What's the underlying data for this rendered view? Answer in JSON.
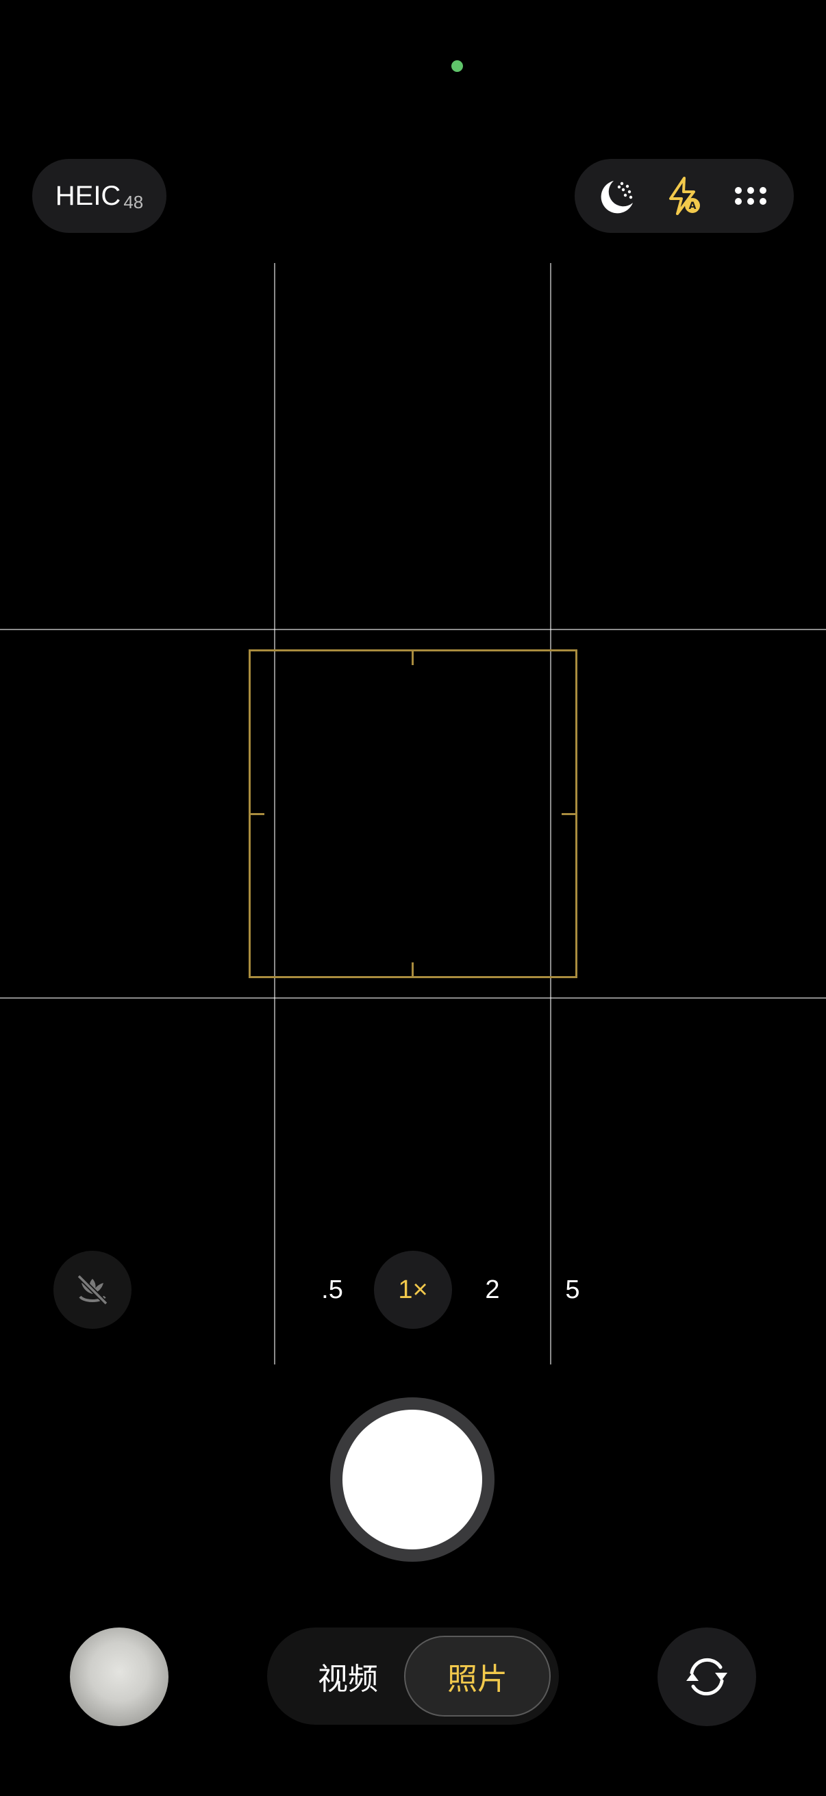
{
  "status": {
    "privacy_indicator_color": "#5fc46a"
  },
  "top_bar": {
    "format_label": "HEIC",
    "format_sub": "48",
    "quick_icons": [
      "night-mode-icon",
      "flash-auto-icon",
      "more-icon"
    ],
    "accent_color": "#f2c94c"
  },
  "viewfinder": {
    "grid": "3x3",
    "focus_color": "#a98c3e"
  },
  "zoom": {
    "macro_icon": "macro-off-icon",
    "options": [
      ".5",
      "1×",
      "2",
      "5"
    ],
    "selected": "1×"
  },
  "shutter": {
    "icon": "shutter-button"
  },
  "modes": {
    "items": [
      "视频",
      "照片"
    ],
    "selected": "照片"
  },
  "bottom": {
    "gallery_icon": "gallery-thumbnail",
    "switch_icon": "switch-camera-icon"
  }
}
